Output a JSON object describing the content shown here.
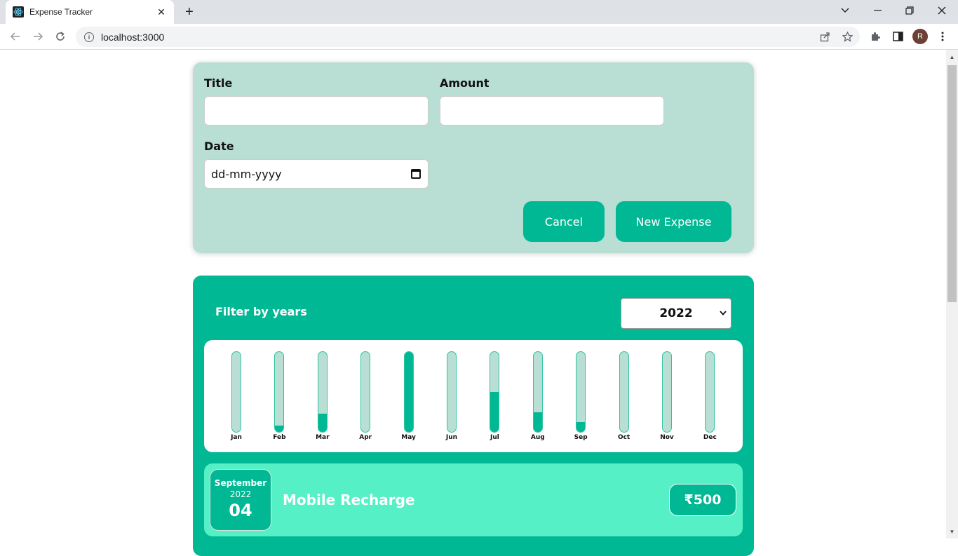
{
  "browser": {
    "tab_title": "Expense Tracker",
    "url": "localhost:3000",
    "avatar_letter": "R"
  },
  "form": {
    "title_label": "Title",
    "title_value": "",
    "amount_label": "Amount",
    "amount_value": "",
    "date_label": "Date",
    "date_placeholder": "dd-mm-yyyy",
    "cancel_label": "Cancel",
    "submit_label": "New Expense"
  },
  "filter": {
    "label": "Filter by years",
    "selected_year": "2022"
  },
  "chart_data": {
    "type": "bar",
    "categories": [
      "Jan",
      "Feb",
      "Mar",
      "Apr",
      "May",
      "Jun",
      "Jul",
      "Aug",
      "Sep",
      "Oct",
      "Nov",
      "Dec"
    ],
    "values": [
      0,
      0.08,
      0.23,
      0,
      1.0,
      0,
      0.5,
      0.25,
      0.12,
      0,
      0,
      0
    ]
  },
  "expense_items": [
    {
      "month": "September",
      "year": "2022",
      "day": "04",
      "title": "Mobile Recharge",
      "amount": "₹500"
    }
  ],
  "colors": {
    "accent": "#00b894",
    "form_bg": "#b9dfd4",
    "item_bg": "#55f0c5"
  }
}
